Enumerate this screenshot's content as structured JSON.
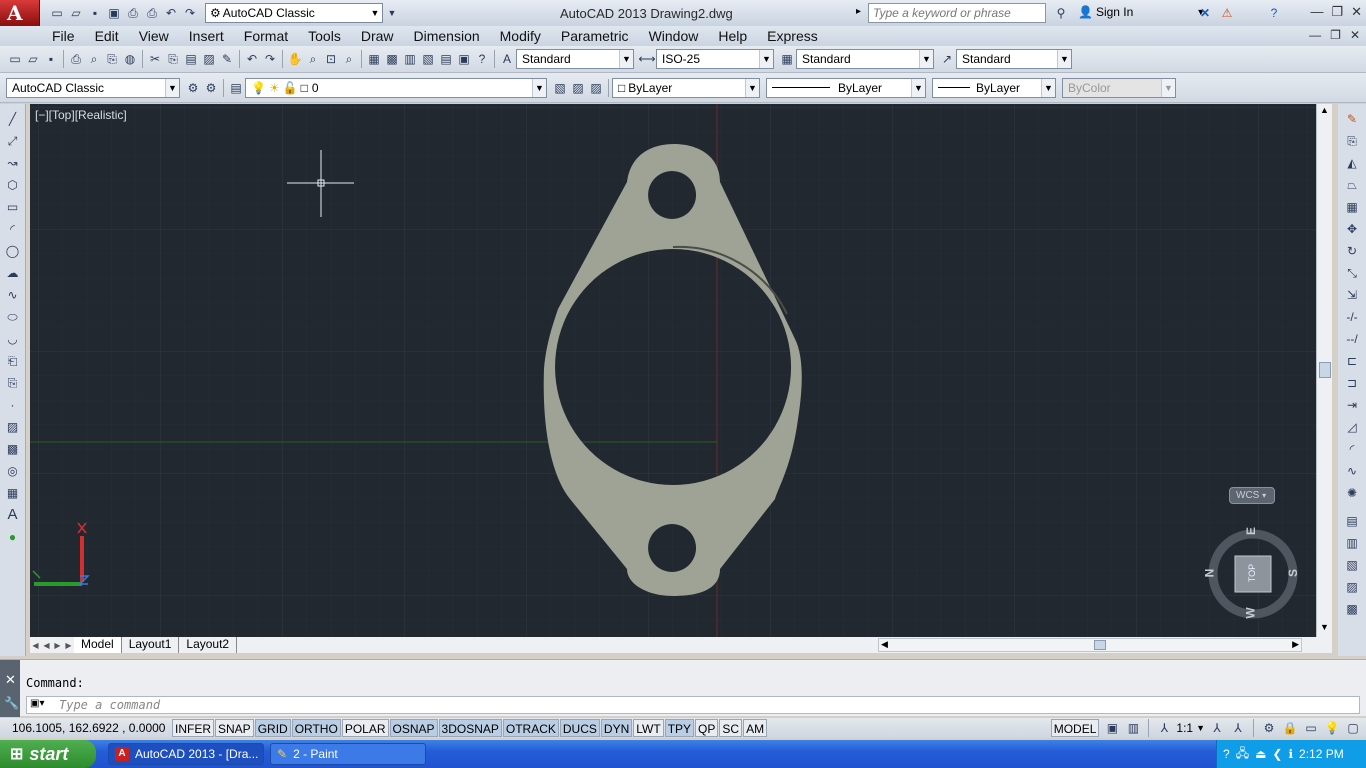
{
  "title_bar": {
    "app_title": "AutoCAD 2013   Drawing2.dwg",
    "workspace": "AutoCAD Classic",
    "search_placeholder": "Type a keyword or phrase",
    "sign_in": "Sign In",
    "app_logo_letter": "A"
  },
  "menu": [
    "File",
    "Edit",
    "View",
    "Insert",
    "Format",
    "Tools",
    "Draw",
    "Dimension",
    "Modify",
    "Parametric",
    "Window",
    "Help",
    "Express"
  ],
  "styles_toolbar": {
    "text_style": "Standard",
    "dim_style": "ISO-25",
    "table_style": "Standard",
    "multileader_style": "Standard"
  },
  "layers_toolbar": {
    "workspace": "AutoCAD Classic",
    "current_layer": "0",
    "color": "ByLayer",
    "linetype": "ByLayer",
    "lineweight": "ByLayer",
    "plot_style": "ByColor"
  },
  "viewport": {
    "label": "[−][Top][Realistic]",
    "wcs": "WCS",
    "viewcube": {
      "face": "TOP",
      "north": "N",
      "south": "S",
      "east": "E",
      "west": "W"
    },
    "background": "#212830",
    "part_color": "#9fa396"
  },
  "layout_tabs": [
    "Model",
    "Layout1",
    "Layout2"
  ],
  "command_line": {
    "history": "Command:",
    "placeholder": "Type a command"
  },
  "status_bar": {
    "coords": "106.1005, 162.6922 , 0.0000",
    "toggles": [
      {
        "label": "INFER",
        "on": false
      },
      {
        "label": "SNAP",
        "on": false
      },
      {
        "label": "GRID",
        "on": true
      },
      {
        "label": "ORTHO",
        "on": true
      },
      {
        "label": "POLAR",
        "on": false
      },
      {
        "label": "OSNAP",
        "on": true
      },
      {
        "label": "3DOSNAP",
        "on": true
      },
      {
        "label": "OTRACK",
        "on": true
      },
      {
        "label": "DUCS",
        "on": true
      },
      {
        "label": "DYN",
        "on": true
      },
      {
        "label": "LWT",
        "on": false
      },
      {
        "label": "TPY",
        "on": true
      },
      {
        "label": "QP",
        "on": false
      },
      {
        "label": "SC",
        "on": false
      },
      {
        "label": "AM",
        "on": false
      }
    ],
    "space": "MODEL",
    "scale": "1:1"
  },
  "taskbar": {
    "start": "start",
    "tasks": [
      "AutoCAD 2013 - [Dra...",
      "2 - Paint"
    ],
    "clock": "2:12 PM"
  }
}
